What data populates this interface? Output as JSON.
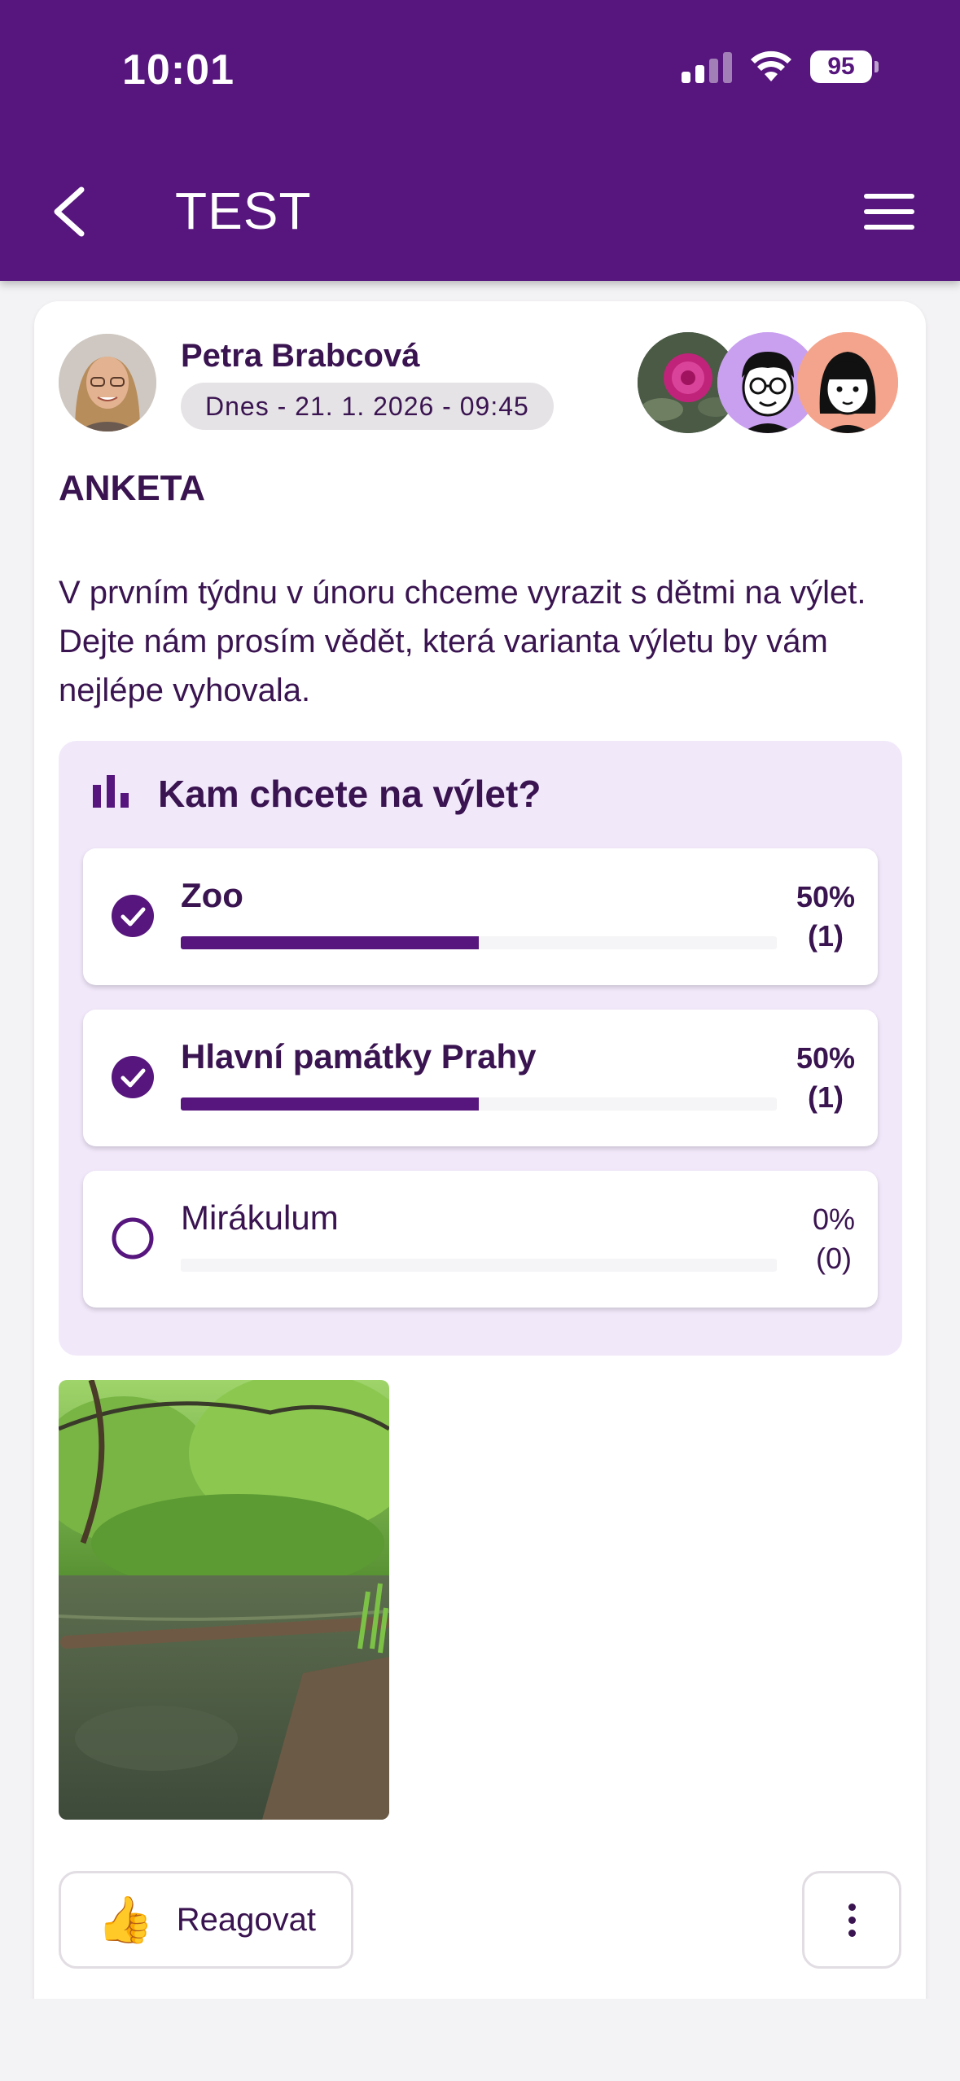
{
  "status_bar": {
    "time": "10:01",
    "battery": "95",
    "icons": [
      "signal-icon",
      "wifi-icon",
      "battery-icon"
    ]
  },
  "header": {
    "title": "TEST",
    "back_icon": "chevron-left-icon",
    "menu_icon": "hamburger-menu-icon",
    "color": "#56167d"
  },
  "post": {
    "author": "Petra Brabcová",
    "date": "Dnes - 21. 1. 2026 - 09:45",
    "participants": [
      "rose-avatar",
      "boy-glasses-avatar",
      "girl-avatar"
    ],
    "title": "ANKETA",
    "body": "V prvním týdnu v únoru chceme vyrazit s dětmi na výlet. Dejte nám prosím vědět, která varianta výletu by vám nejlépe vyhovala."
  },
  "poll": {
    "question": "Kam chcete na výlet?",
    "icon": "bar-chart-icon",
    "options": [
      {
        "label": "Zoo",
        "percent": "50%",
        "count": "(1)",
        "fraction": 0.5,
        "selected": true
      },
      {
        "label": "Hlavní památky Prahy",
        "percent": "50%",
        "count": "(1)",
        "fraction": 0.5,
        "selected": true
      },
      {
        "label": "Mirákulum",
        "percent": "0%",
        "count": "(0)",
        "fraction": 0,
        "selected": false
      }
    ]
  },
  "actions": {
    "react_label": "Reagovat",
    "react_icon": "👍",
    "more_icon": "more-vertical-icon"
  },
  "colors": {
    "accent": "#56167d",
    "poll_bg": "#f1e8fa",
    "text": "#3a1450"
  }
}
